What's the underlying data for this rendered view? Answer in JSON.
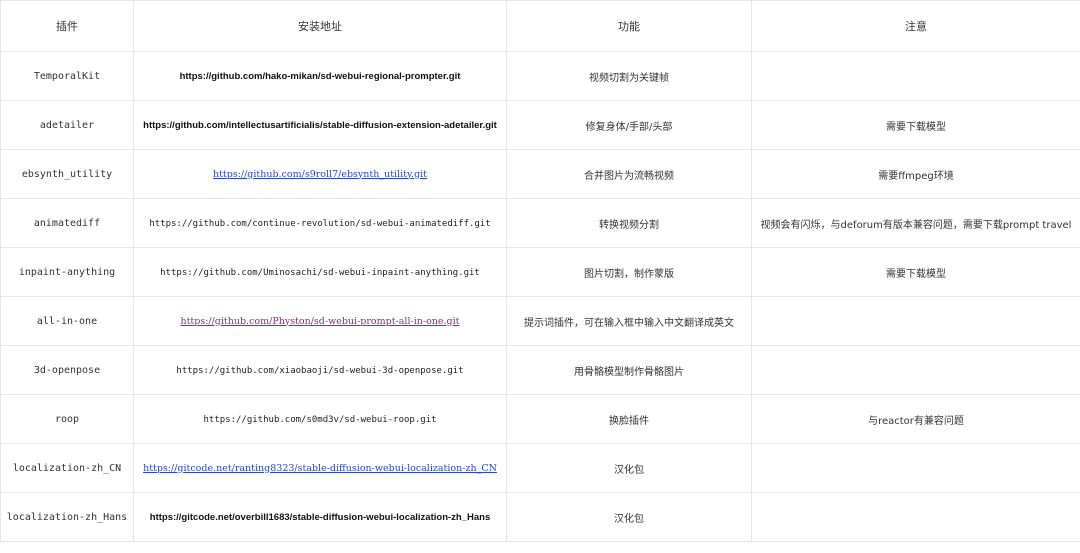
{
  "table": {
    "headers": [
      "插件",
      "安装地址",
      "功能",
      "注意"
    ],
    "rows": [
      {
        "name": "TemporalKit",
        "url": "https://github.com/hako-mikan/sd-webui-regional-prompter.git",
        "url_style": "bold",
        "function": "视频切割为关键帧",
        "note": ""
      },
      {
        "name": "adetailer",
        "url": "https://github.com/intellectusartificialis/stable-diffusion-extension-adetailer.git",
        "url_style": "bold",
        "function": "修复身体/手部/头部",
        "note": "需要下载模型"
      },
      {
        "name": "ebsynth_utility",
        "url": "https://github.com/s9roll7/ebsynth_utility.git",
        "url_style": "link-blue",
        "function": "合并图片为流畅视频",
        "note": "需要ffmpeg环境"
      },
      {
        "name": "animatediff",
        "url": "https://github.com/continue-revolution/sd-webui-animatediff.git",
        "url_style": "plain",
        "function": "转换视频分割",
        "note": "视频会有闪烁，与deforum有版本兼容问题，需要下载prompt travel"
      },
      {
        "name": "inpaint-anything",
        "url": "https://github.com/Uminosachi/sd-webui-inpaint-anything.git",
        "url_style": "plain",
        "function": "图片切割，制作蒙版",
        "note": "需要下载模型"
      },
      {
        "name": "all-in-one",
        "url": "https://github.com/Physton/sd-webui-prompt-all-in-one.git",
        "url_style": "link-purple",
        "function": "提示词插件，可在输入框中输入中文翻译成英文",
        "note": ""
      },
      {
        "name": "3d-openpose",
        "url": "https://github.com/xiaobaoji/sd-webui-3d-openpose.git",
        "url_style": "plain",
        "function": "用骨骼模型制作骨骼图片",
        "note": ""
      },
      {
        "name": "roop",
        "url": "https://github.com/s0md3v/sd-webui-roop.git",
        "url_style": "plain",
        "function": "换脸插件",
        "note": "与reactor有兼容问题"
      },
      {
        "name": "localization-zh_CN",
        "url": "https://gitcode.net/ranting8323/stable-diffusion-webui-localization-zh_CN",
        "url_style": "link-blue",
        "function": "汉化包",
        "note": ""
      },
      {
        "name": "localization-zh_Hans",
        "url": "https://gitcode.net/overbill1683/stable-diffusion-webui-localization-zh_Hans",
        "url_style": "bold",
        "function": "汉化包",
        "note": ""
      }
    ]
  }
}
